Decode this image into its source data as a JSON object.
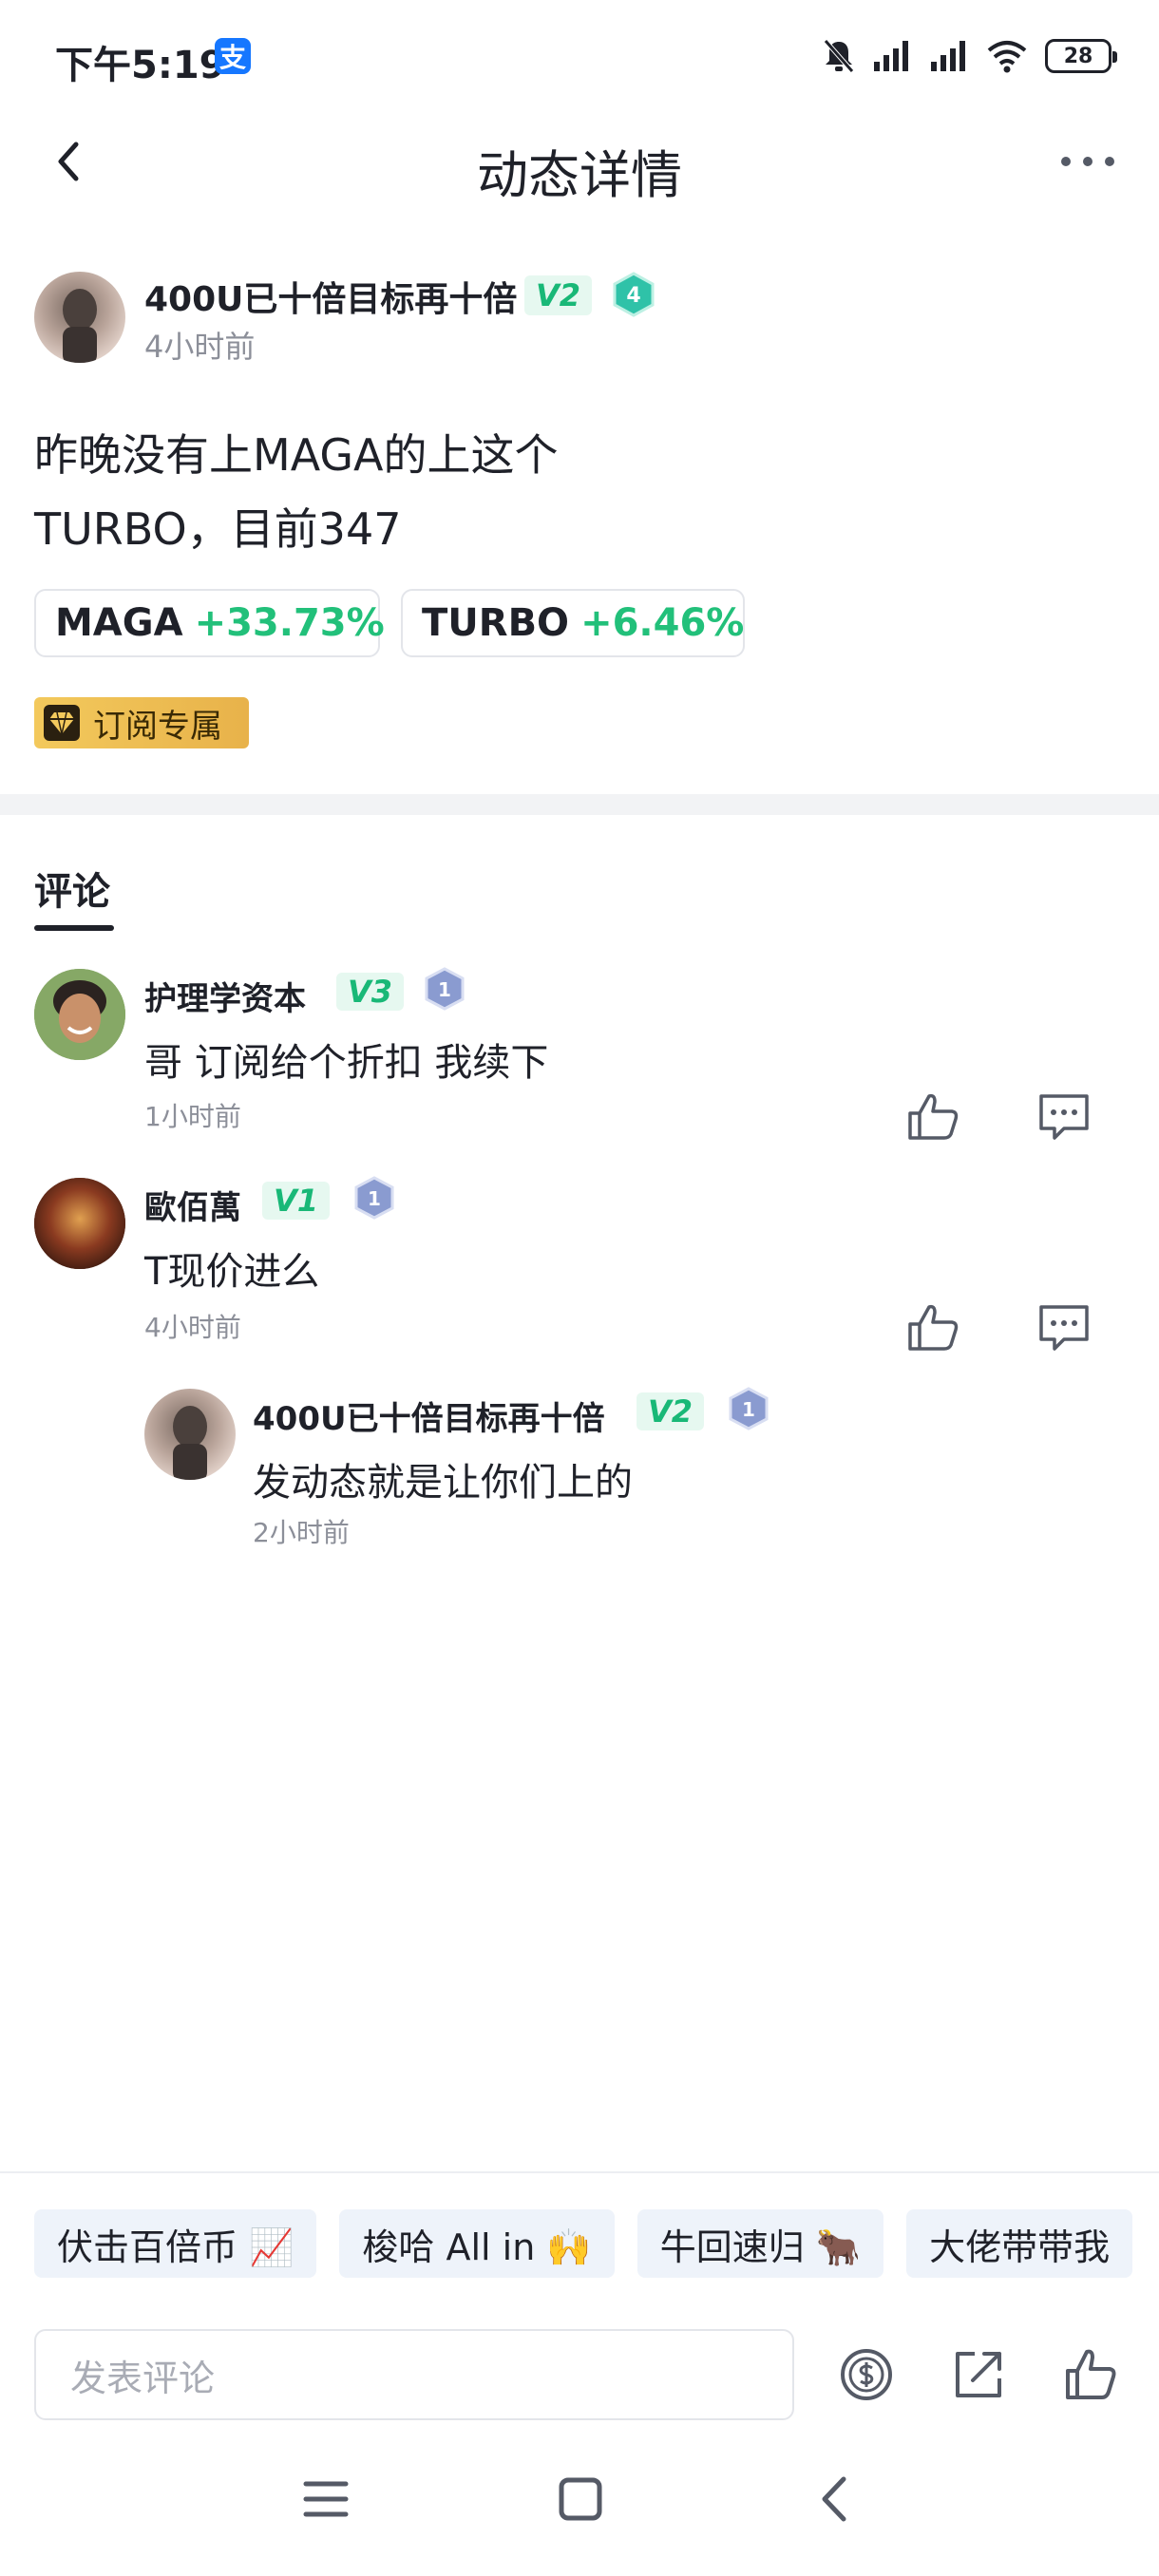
{
  "status_bar": {
    "time": "下午5:19",
    "app_badge": "支",
    "battery": "28",
    "icons": [
      "bell-muted-icon",
      "signal-icon",
      "signal-icon",
      "wifi-icon",
      "battery-icon"
    ]
  },
  "nav": {
    "title": "动态详情",
    "back_icon": "back-arrow-icon",
    "more_icon": "more-dots-icon"
  },
  "post": {
    "author": "400U已十倍目标再十倍",
    "vip": "V2",
    "level": "4",
    "time": "4小时前",
    "content_line1": "昨晚没有上MAGA的上这个",
    "content_line2": "TURBO，目前347",
    "coins": [
      {
        "symbol": "MAGA",
        "change": "+33.73%"
      },
      {
        "symbol": "TURBO",
        "change": "+6.46%"
      }
    ],
    "tag": "订阅专属"
  },
  "comments": {
    "heading": "评论",
    "items": [
      {
        "name": "护理学资本",
        "vip": "V3",
        "level": "1",
        "text": "哥 订阅给个折扣 我续下",
        "time": "1小时前"
      },
      {
        "name": "歐佰萬",
        "vip": "V1",
        "level": "1",
        "text": "T现价进么",
        "time": "4小时前",
        "reply": {
          "name": "400U已十倍目标再十倍",
          "vip": "V2",
          "level": "1",
          "text": "发动态就是让你们上的",
          "time": "2小时前"
        }
      }
    ]
  },
  "quick_replies": [
    "伏击百倍币 📈",
    "梭哈 All in 🙌",
    "牛回速归 🐂",
    "大佬带带我"
  ],
  "bottom_bar": {
    "input_placeholder": "发表评论",
    "icons": [
      "tip-coin-icon",
      "share-icon",
      "like-icon"
    ]
  },
  "colors": {
    "accent_green": "#22c07a",
    "vip_green": "#19b877",
    "level_teal": "#2fc2a8",
    "level_blue": "#8a9bd0",
    "gold": "#e8b24a"
  }
}
